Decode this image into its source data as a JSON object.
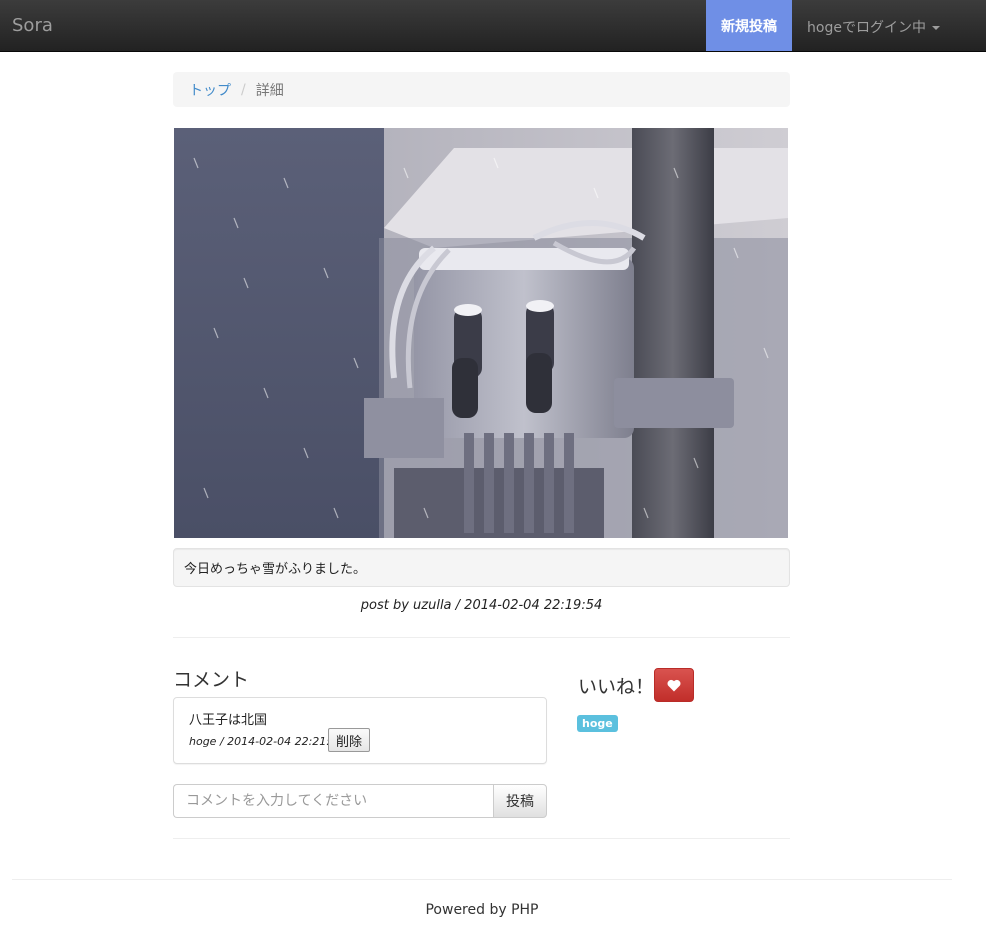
{
  "navbar": {
    "brand": "Sora",
    "new_post_label": "新規投稿",
    "user_label": "hogeでログイン中"
  },
  "breadcrumb": {
    "top_label": "トップ",
    "separator": "/",
    "current_label": "詳細"
  },
  "post": {
    "caption": "今日めっちゃ雪がふりました。",
    "meta": "post by uzulla / 2014-02-04 22:19:54"
  },
  "comments": {
    "title": "コメント",
    "items": [
      {
        "text": "八王子は北国",
        "meta": "hoge / 2014-02-04 22:21:10",
        "delete_label": "削除"
      }
    ],
    "input_placeholder": "コメントを入力してください",
    "submit_label": "投稿"
  },
  "like": {
    "label": "いいね！",
    "icon": "heart-icon",
    "users": [
      "hoge"
    ]
  },
  "footer": {
    "text": "Powered by PHP"
  },
  "colors": {
    "navbar": "#222222",
    "new_post_bg": "#6f8fe6",
    "link": "#428bca",
    "danger": "#d9534f",
    "tag": "#5bc0de"
  }
}
